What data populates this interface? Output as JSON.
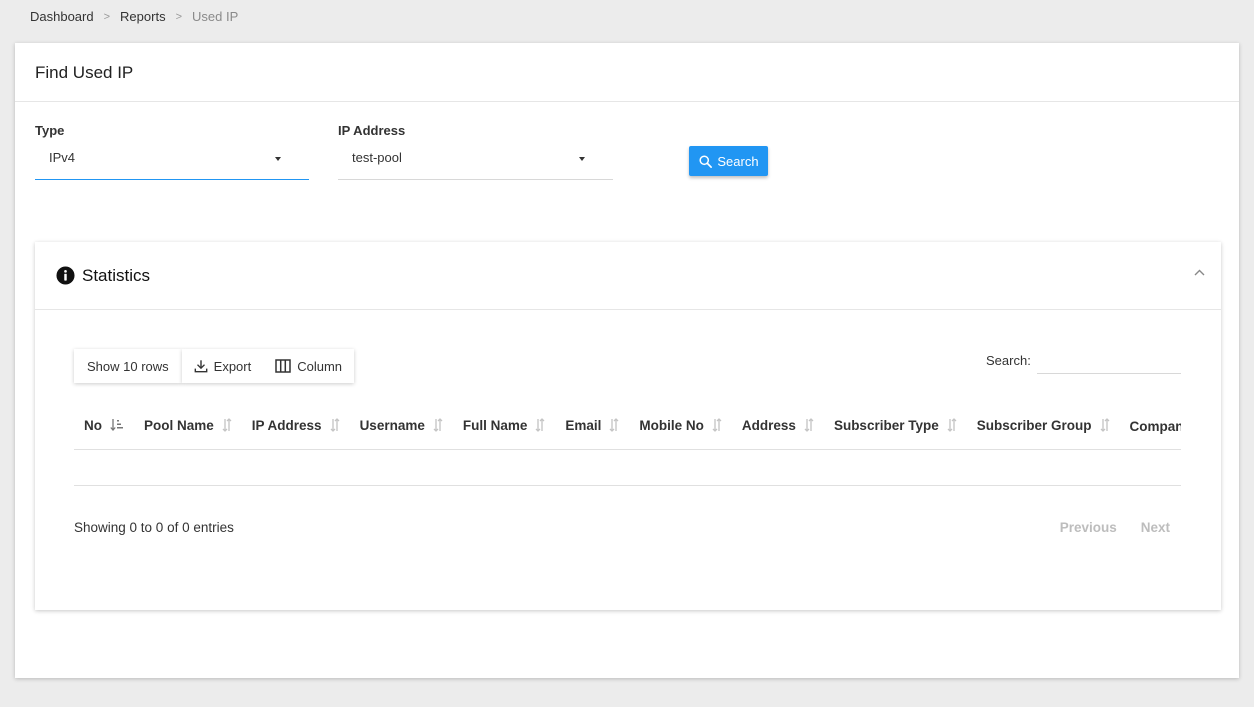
{
  "breadcrumb": {
    "items": [
      "Dashboard",
      "Reports"
    ],
    "current": "Used IP",
    "separator": ">"
  },
  "page": {
    "title": "Find Used IP"
  },
  "form": {
    "type_label": "Type",
    "type_value": "IPv4",
    "ip_label": "IP Address",
    "ip_value": "test-pool",
    "search_button": "Search"
  },
  "statistics": {
    "title": "Statistics",
    "toolbar": {
      "show_rows": "Show 10 rows",
      "export": "Export",
      "column": "Column"
    },
    "search_label": "Search:",
    "search_value": "",
    "columns": [
      "No",
      "Pool Name",
      "IP Address",
      "Username",
      "Full Name",
      "Email",
      "Mobile No",
      "Address",
      "Subscriber Type",
      "Subscriber Group",
      "Company Name"
    ],
    "rows": [],
    "info": "Showing 0 to 0 of 0 entries",
    "pager": {
      "previous": "Previous",
      "next": "Next"
    }
  },
  "colors": {
    "accent": "#2196f3",
    "background": "#ececec",
    "disabled_text": "#bdbdbd"
  }
}
